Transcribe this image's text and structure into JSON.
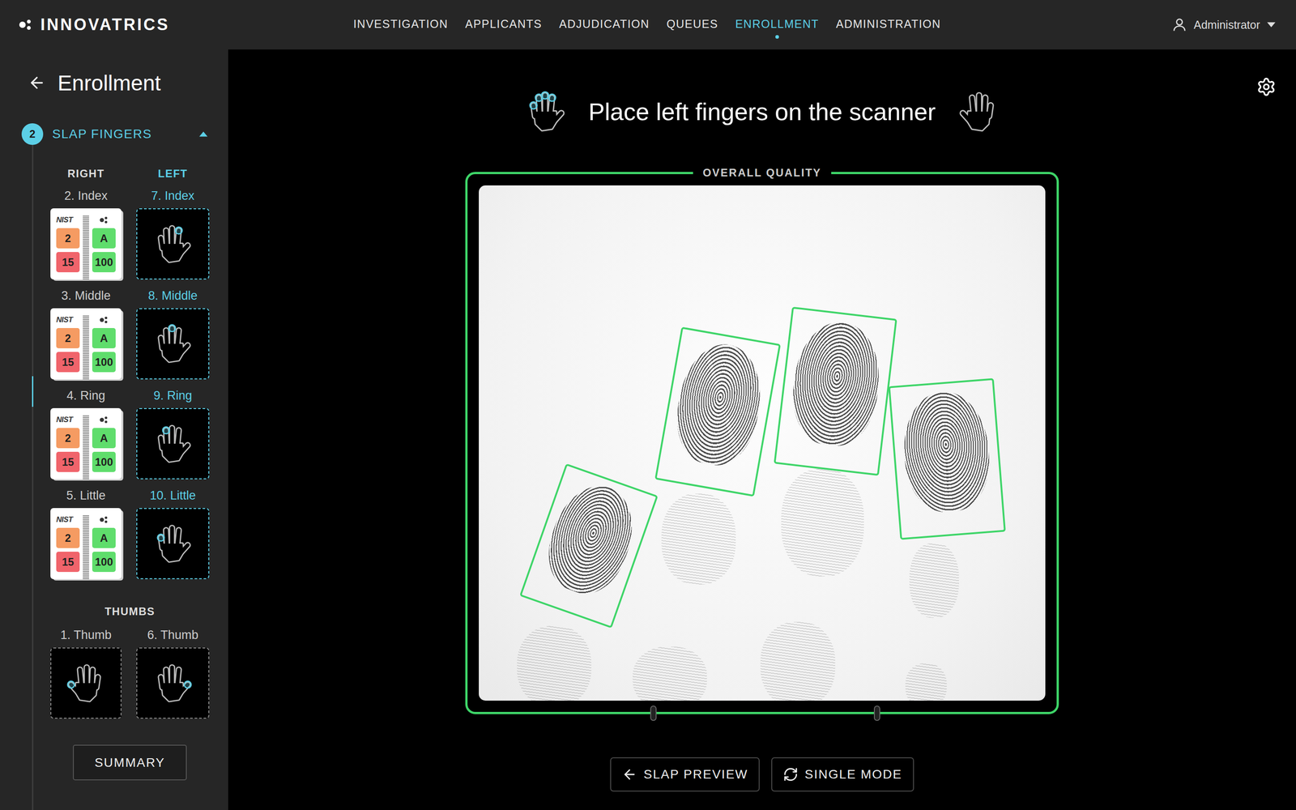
{
  "brand": {
    "name": "INNOVATRICS"
  },
  "nav": [
    {
      "label": "INVESTIGATION",
      "selected": false
    },
    {
      "label": "APPLICANTS",
      "selected": false
    },
    {
      "label": "ADJUDICATION",
      "selected": false
    },
    {
      "label": "QUEUES",
      "selected": false
    },
    {
      "label": "ENROLLMENT",
      "selected": true
    },
    {
      "label": "ADMINISTRATION",
      "selected": false
    }
  ],
  "user": {
    "name": "Administrator"
  },
  "sidebar": {
    "title": "Enrollment",
    "step": {
      "number": "2",
      "label": "SLAP FINGERS",
      "expanded": true
    },
    "hands": [
      {
        "label": "RIGHT",
        "selected": false
      },
      {
        "label": "LEFT",
        "selected": true
      }
    ],
    "finger_rows": [
      {
        "right": {
          "label": "2. Index",
          "captured": true,
          "active": false,
          "nist_label": "NIST",
          "nist": [
            {
              "value": "2",
              "color": "#f59b62"
            },
            {
              "value": "15",
              "color": "#f0646b"
            }
          ],
          "scores": [
            {
              "value": "A",
              "color": "#5fdd6c"
            },
            {
              "value": "100",
              "color": "#5fdd6c"
            }
          ]
        },
        "left": {
          "label": "7. Index",
          "captured": false,
          "active": true
        }
      },
      {
        "right": {
          "label": "3. Middle",
          "captured": true,
          "active": false,
          "nist_label": "NIST",
          "nist": [
            {
              "value": "2",
              "color": "#f59b62"
            },
            {
              "value": "15",
              "color": "#f0646b"
            }
          ],
          "scores": [
            {
              "value": "A",
              "color": "#5fdd6c"
            },
            {
              "value": "100",
              "color": "#5fdd6c"
            }
          ]
        },
        "left": {
          "label": "8. Middle",
          "captured": false,
          "active": true
        }
      },
      {
        "right": {
          "label": "4. Ring",
          "captured": true,
          "active": false,
          "nist_label": "NIST",
          "nist": [
            {
              "value": "2",
              "color": "#f59b62"
            },
            {
              "value": "15",
              "color": "#f0646b"
            }
          ],
          "scores": [
            {
              "value": "A",
              "color": "#5fdd6c"
            },
            {
              "value": "100",
              "color": "#5fdd6c"
            }
          ]
        },
        "left": {
          "label": "9. Ring",
          "captured": false,
          "active": true
        }
      },
      {
        "right": {
          "label": "5. Little",
          "captured": true,
          "active": false,
          "nist_label": "NIST",
          "nist": [
            {
              "value": "2",
              "color": "#f59b62"
            },
            {
              "value": "15",
              "color": "#f0646b"
            }
          ],
          "scores": [
            {
              "value": "A",
              "color": "#5fdd6c"
            },
            {
              "value": "100",
              "color": "#5fdd6c"
            }
          ]
        },
        "left": {
          "label": "10. Little",
          "captured": false,
          "active": true
        }
      }
    ],
    "thumbs_title": "THUMBS",
    "thumbs": [
      {
        "label": "1. Thumb",
        "captured": false,
        "active": false
      },
      {
        "label": "6. Thumb",
        "captured": false,
        "active": false
      }
    ],
    "summary": "SUMMARY"
  },
  "main": {
    "title": "Place left fingers on the scanner",
    "quality_label": "OVERALL QUALITY",
    "quality_ok": true,
    "detections": [
      {
        "ok": true
      },
      {
        "ok": true
      },
      {
        "ok": true
      },
      {
        "ok": true
      }
    ],
    "buttons": [
      {
        "label": "SLAP PREVIEW"
      },
      {
        "label": "SINGLE MODE"
      }
    ]
  }
}
